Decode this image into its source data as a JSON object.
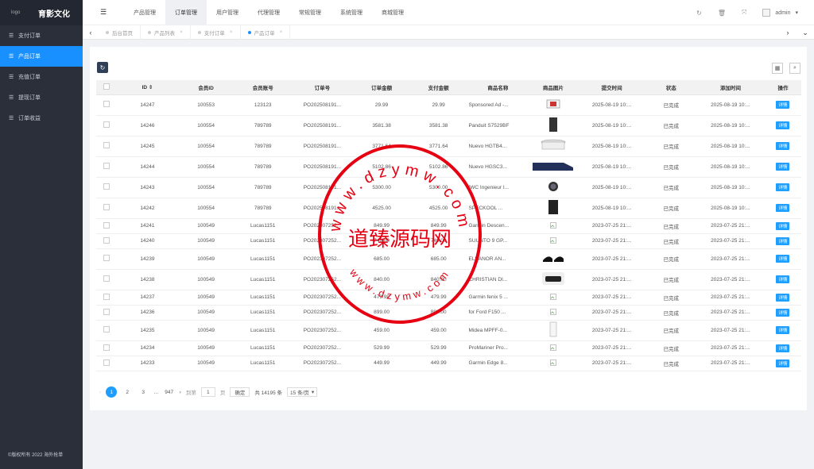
{
  "sidebar": {
    "logo_alt": "logo",
    "title": "育影文化",
    "items": [
      {
        "label": "支付订单"
      },
      {
        "label": "产品订单"
      },
      {
        "label": "充值订单"
      },
      {
        "label": "提现订单"
      },
      {
        "label": "订单收益"
      }
    ],
    "copyright": "©版权所有 2022 海外抢单"
  },
  "header": {
    "nav": [
      "产品管理",
      "订单管理",
      "用户管理",
      "代理管理",
      "常规管理",
      "系统管理",
      "商城管理"
    ],
    "user": "admin"
  },
  "tabs": [
    {
      "label": "后台首页",
      "close": ""
    },
    {
      "label": "产品列表",
      "close": "×"
    },
    {
      "label": "支付订单",
      "close": "×"
    },
    {
      "label": "产品订单",
      "close": "×"
    }
  ],
  "table": {
    "headers": [
      "ID",
      "会员ID",
      "会员账号",
      "订单号",
      "订单金额",
      "支付金额",
      "商品名称",
      "商品图片",
      "提交时间",
      "状态",
      "添加时间",
      "操作"
    ],
    "detail_label": "详情",
    "rows": [
      {
        "id": "14247",
        "member_id": "100553",
        "account": "123123",
        "order_no": "PO202508191...",
        "amount": "29.99",
        "paid": "29.99",
        "product": "Sponsored Ad -...",
        "submit": "2025-08-19 10:...",
        "status": "已完成",
        "added": "2025-08-19 10:..."
      },
      {
        "id": "14246",
        "member_id": "100554",
        "account": "789789",
        "order_no": "PO202508191...",
        "amount": "3581.38",
        "paid": "3581.38",
        "product": "Panduit S7529BF",
        "submit": "2025-08-19 10:...",
        "status": "已完成",
        "added": "2025-08-19 10:..."
      },
      {
        "id": "14245",
        "member_id": "100554",
        "account": "789789",
        "order_no": "PO202508191...",
        "amount": "3771.64",
        "paid": "3771.64",
        "product": "Nuevo HGTB4...",
        "submit": "2025-08-19 10:...",
        "status": "已完成",
        "added": "2025-08-19 10:..."
      },
      {
        "id": "14244",
        "member_id": "100554",
        "account": "789789",
        "order_no": "PO202508191...",
        "amount": "5102.86",
        "paid": "5102.86",
        "product": "Nuevo HGSC3...",
        "submit": "2025-08-19 10:...",
        "status": "已完成",
        "added": "2025-08-19 10:..."
      },
      {
        "id": "14243",
        "member_id": "100554",
        "account": "789789",
        "order_no": "PO202508191...",
        "amount": "5300.00",
        "paid": "5300.00",
        "product": "IWC Ingenieur I...",
        "submit": "2025-08-19 10:...",
        "status": "已完成",
        "added": "2025-08-19 10:..."
      },
      {
        "id": "14242",
        "member_id": "100554",
        "account": "789789",
        "order_no": "PO202508191...",
        "amount": "4525.00",
        "paid": "4525.00",
        "product": "SPECKOOL ...",
        "submit": "2025-08-19 10:...",
        "status": "已完成",
        "added": "2025-08-19 10:..."
      },
      {
        "id": "14241",
        "member_id": "100549",
        "account": "Lucas1151",
        "order_no": "PO202307252...",
        "amount": "849.99",
        "paid": "849.99",
        "product": "Garmin Descen...",
        "submit": "2023-07-25 21:...",
        "status": "已完成",
        "added": "2023-07-25 21:..."
      },
      {
        "id": "14240",
        "member_id": "100549",
        "account": "Lucas1151",
        "order_no": "PO202307252...",
        "amount": "749.00",
        "paid": "749.00",
        "product": "SUUNTO 9 GP...",
        "submit": "2023-07-25 21:...",
        "status": "已完成",
        "added": "2023-07-25 21:..."
      },
      {
        "id": "14239",
        "member_id": "100549",
        "account": "Lucas1151",
        "order_no": "PO202307252...",
        "amount": "685.00",
        "paid": "685.00",
        "product": "ELEANOR AN...",
        "submit": "2023-07-25 21:...",
        "status": "已完成",
        "added": "2023-07-25 21:..."
      },
      {
        "id": "14238",
        "member_id": "100549",
        "account": "Lucas1151",
        "order_no": "PO202307252...",
        "amount": "840.00",
        "paid": "840.00",
        "product": "CHRISTIAN DI...",
        "submit": "2023-07-25 21:...",
        "status": "已完成",
        "added": "2023-07-25 21:..."
      },
      {
        "id": "14237",
        "member_id": "100549",
        "account": "Lucas1151",
        "order_no": "PO202307252...",
        "amount": "479.99",
        "paid": "479.99",
        "product": "Garmin fenix 5 ...",
        "submit": "2023-07-25 21:...",
        "status": "已完成",
        "added": "2023-07-25 21:..."
      },
      {
        "id": "14236",
        "member_id": "100549",
        "account": "Lucas1151",
        "order_no": "PO202307252...",
        "amount": "899.00",
        "paid": "899.00",
        "product": "for Ford F150 ...",
        "submit": "2023-07-25 21:...",
        "status": "已完成",
        "added": "2023-07-25 21:..."
      },
      {
        "id": "14235",
        "member_id": "100549",
        "account": "Lucas1151",
        "order_no": "PO202307252...",
        "amount": "459.00",
        "paid": "459.00",
        "product": "Midea MPFF-0...",
        "submit": "2023-07-25 21:...",
        "status": "已完成",
        "added": "2023-07-25 21:..."
      },
      {
        "id": "14234",
        "member_id": "100549",
        "account": "Lucas1151",
        "order_no": "PO202307252...",
        "amount": "529.99",
        "paid": "529.99",
        "product": "ProMariner Pro...",
        "submit": "2023-07-25 21:...",
        "status": "已完成",
        "added": "2023-07-25 21:..."
      },
      {
        "id": "14233",
        "member_id": "100549",
        "account": "Lucas1151",
        "order_no": "PO202307252...",
        "amount": "449.99",
        "paid": "449.99",
        "product": "Garmin Edge 8...",
        "submit": "2023-07-25 21:...",
        "status": "已完成",
        "added": "2023-07-25 21:..."
      }
    ]
  },
  "pager": {
    "pages": [
      "1",
      "2",
      "3",
      "…",
      "947"
    ],
    "goto_label": "到第",
    "current": "1",
    "page_unit": "页",
    "confirm": "确定",
    "total": "共 14195 条",
    "size": "15 条/页"
  },
  "watermark": {
    "center": "道臻源码网",
    "top_arc": "www.dzymw.com",
    "bottom_arc": "www.dzymw.com"
  },
  "colors": {
    "sidebar_bg": "#2b2f3a",
    "accent": "#1890ff",
    "detail_button": "#1e9fff",
    "watermark": "#e60012"
  }
}
